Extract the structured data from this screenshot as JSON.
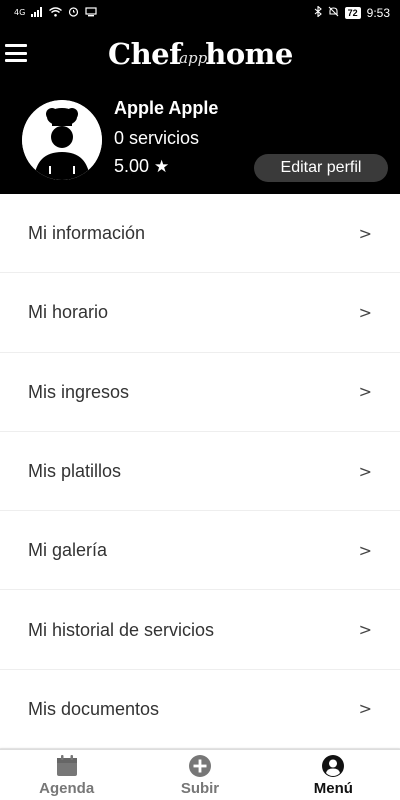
{
  "status_bar": {
    "left_icons": [
      "network-type-icon",
      "signal-icon",
      "wifi-icon",
      "alarm-icon",
      "cast-icon"
    ],
    "battery": "72",
    "time": "9:53"
  },
  "header": {
    "brand_left": "Chef",
    "brand_script": "app",
    "brand_right": "home"
  },
  "profile": {
    "name": "Apple Apple",
    "services": "0 servicios",
    "rating": "5.00",
    "edit_label": "Editar perfil"
  },
  "menu": {
    "items": [
      {
        "label": "Mi información",
        "chevron": ">"
      },
      {
        "label": "Mi horario",
        "chevron": ">"
      },
      {
        "label": "Mis ingresos",
        "chevron": ">"
      },
      {
        "label": "Mis platillos",
        "chevron": ">"
      },
      {
        "label": "Mi galería",
        "chevron": ">"
      },
      {
        "label": "Mi historial de servicios",
        "chevron": ">"
      },
      {
        "label": "Mis documentos",
        "chevron": ">"
      }
    ]
  },
  "bottom_nav": {
    "items": [
      {
        "label": "Agenda",
        "icon": "calendar-icon",
        "active": false
      },
      {
        "label": "Subir",
        "icon": "plus-circle-icon",
        "active": false
      },
      {
        "label": "Menú",
        "icon": "user-circle-icon",
        "active": true
      }
    ]
  },
  "colors": {
    "header_bg": "#000000",
    "edit_button_bg": "#3a3a3a",
    "nav_inactive": "#777777",
    "nav_active": "#111111"
  }
}
